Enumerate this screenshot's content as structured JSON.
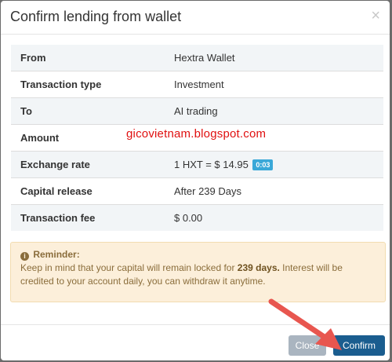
{
  "dialog": {
    "title": "Confirm lending from wallet",
    "close_symbol": "×"
  },
  "details": [
    {
      "label": "From",
      "value": "Hextra Wallet"
    },
    {
      "label": "Transaction type",
      "value": "Investment"
    },
    {
      "label": "To",
      "value": "AI trading"
    },
    {
      "label": "Amount",
      "value": ""
    },
    {
      "label": "Exchange rate",
      "value": "1 HXT = $ 14.95",
      "badge": "0:03"
    },
    {
      "label": "Capital release",
      "value": "After 239 Days"
    },
    {
      "label": "Transaction fee",
      "value": "$ 0.00"
    }
  ],
  "watermark": "gicovietnam.blogspot.com",
  "reminder": {
    "icon": "info-icon",
    "title": "Reminder:",
    "text_before": "Keep in mind that your capital will remain locked for ",
    "text_bold": "239 days.",
    "text_after": " Interest will be credited to your account daily, you can withdraw it anytime."
  },
  "footer": {
    "close_label": "Close",
    "confirm_label": "Confirm"
  },
  "colors": {
    "confirm": "#1a5d8f",
    "close": "#aab5c0",
    "badge": "#3aa8d8",
    "reminder_bg": "#fcefda",
    "arrow": "#e8564f"
  }
}
